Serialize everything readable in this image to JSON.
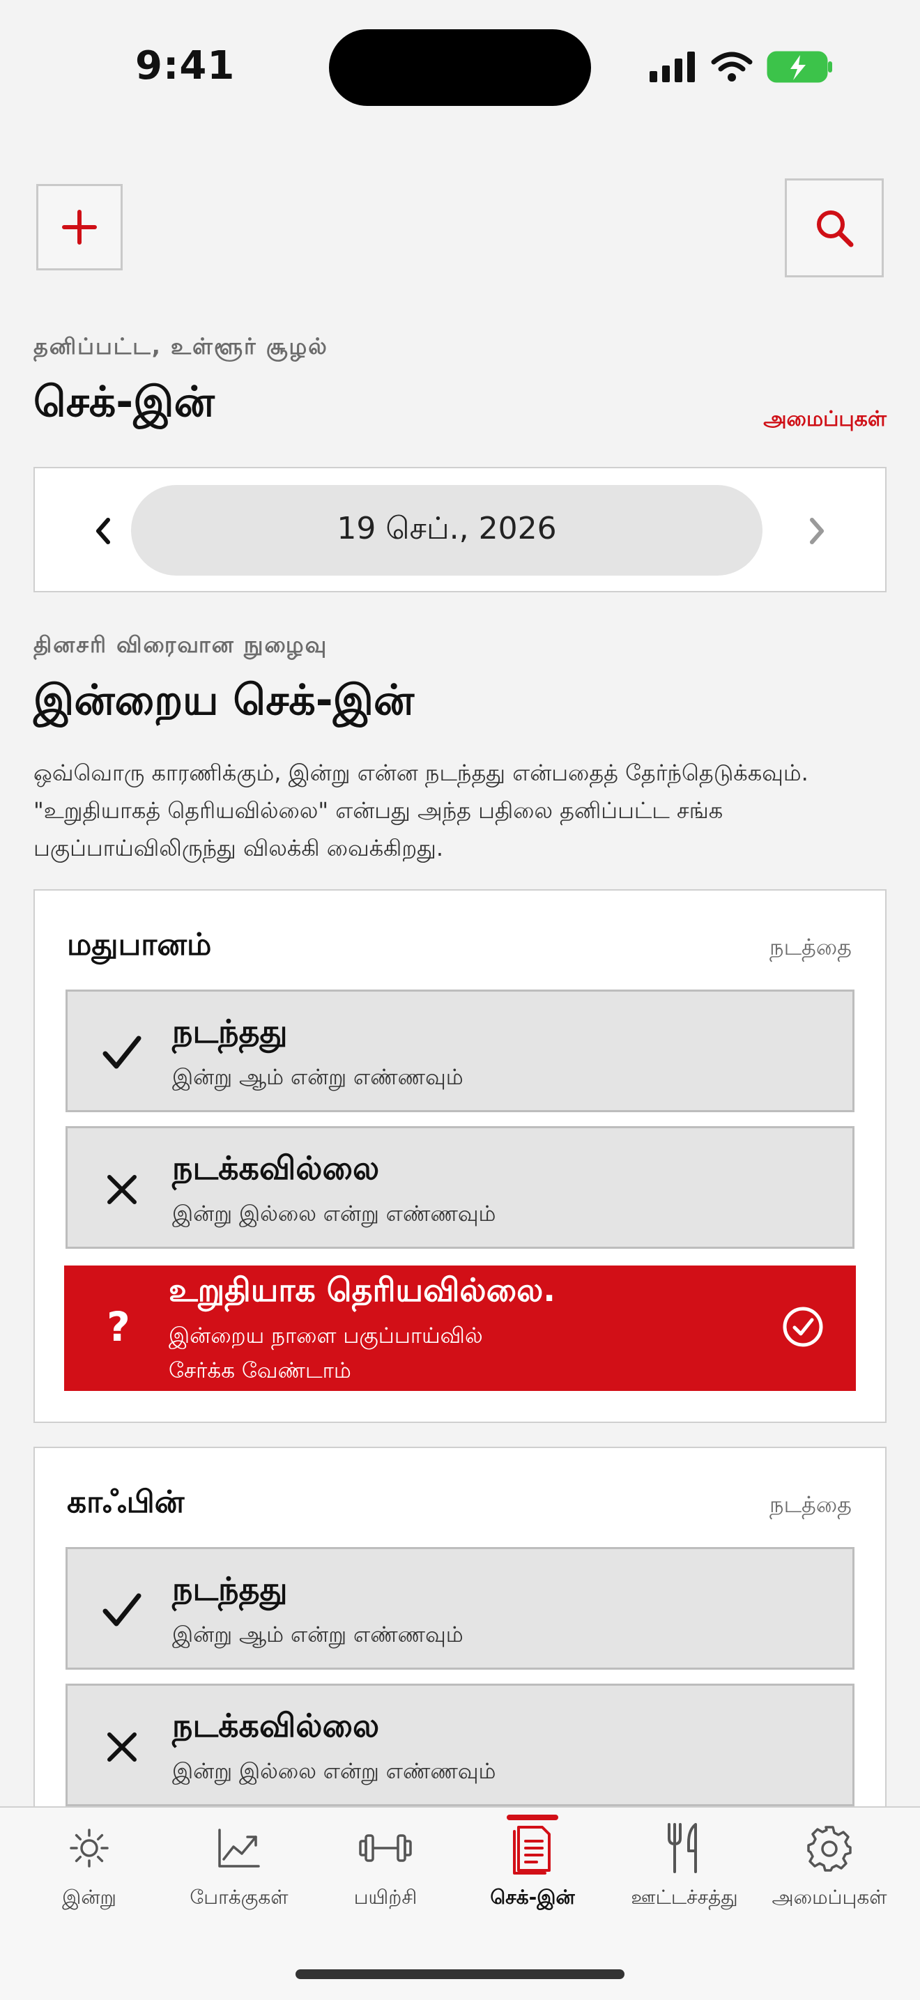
{
  "status_bar": {
    "time": "9:41"
  },
  "header": {
    "context": "தனிப்பட்ட, உள்ளூர் சூழல்",
    "title": "செக்-இன்",
    "settings_link": "அமைப்புகள்"
  },
  "date_nav": {
    "date": "19 செப்., 2026"
  },
  "section": {
    "eyebrow": "தினசரி விரைவான நுழைவு",
    "title": "இன்றைய செக்-இன்",
    "description": "ஒவ்வொரு காரணிக்கும், இன்று என்ன நடந்தது என்பதைத் தேர்ந்தெடுக்கவும். \"உறுதியாகத் தெரியவில்லை\" என்பது அந்த பதிலை தனிப்பட்ட சங்க பகுப்பாய்விலிருந்து விலக்கி வைக்கிறது."
  },
  "factors": [
    {
      "name": "மதுபானம்",
      "edit": "நடத்தை",
      "options": [
        {
          "title": "நடந்தது",
          "subtitle": "இன்று ஆம் என்று எண்ணவும்"
        },
        {
          "title": "நடக்கவில்லை",
          "subtitle": "இன்று இல்லை என்று எண்ணவும்"
        },
        {
          "title": "உறுதியாக தெரியவில்லை.",
          "subtitle_line1": "இன்றைய நாளை பகுப்பாய்வில்",
          "subtitle_line2": "சேர்க்க வேண்டாம்",
          "selected": true
        }
      ]
    },
    {
      "name": "காஃபின்",
      "edit": "நடத்தை",
      "options": [
        {
          "title": "நடந்தது",
          "subtitle": "இன்று ஆம் என்று எண்ணவும்"
        },
        {
          "title": "நடக்கவில்லை",
          "subtitle": "இன்று இல்லை என்று எண்ணவும்"
        }
      ]
    }
  ],
  "tabs": [
    {
      "label": "இன்று",
      "icon": "sun-icon"
    },
    {
      "label": "போக்குகள்",
      "icon": "trend-chart-icon"
    },
    {
      "label": "பயிற்சி",
      "icon": "dumbbell-icon"
    },
    {
      "label": "செக்-இன்",
      "icon": "checkin-clipboard-icon",
      "active": true
    },
    {
      "label": "ஊட்டச்சத்து",
      "icon": "fork-knife-icon"
    },
    {
      "label": "அமைப்புகள்",
      "icon": "gear-icon"
    }
  ],
  "colors": {
    "accent": "#d20f17",
    "background": "#f3f3f3"
  }
}
